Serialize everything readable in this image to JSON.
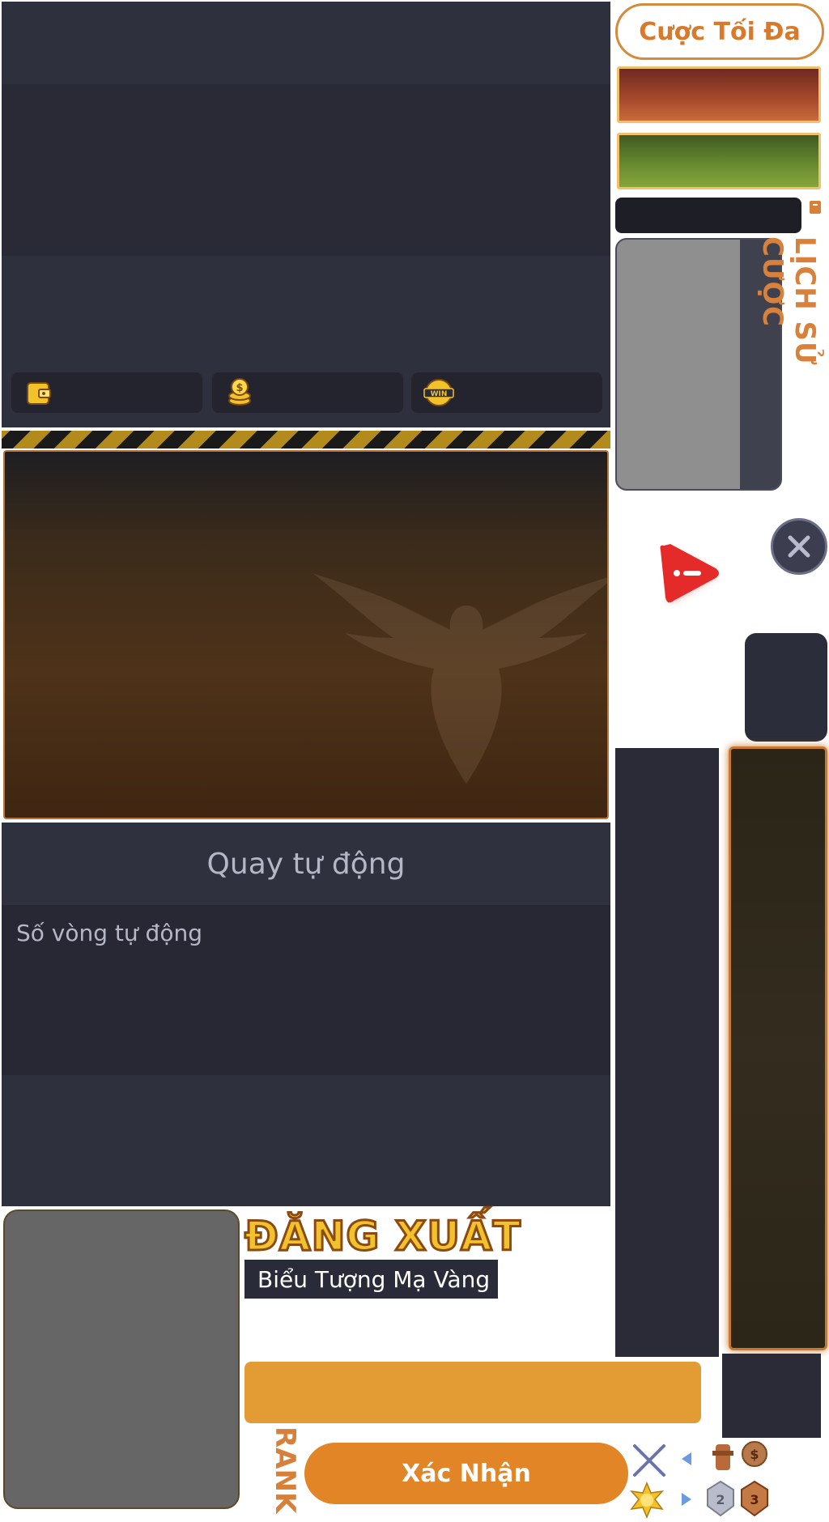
{
  "max_bet": {
    "label": "Cược Tối Đa"
  },
  "history": {
    "title": "LỊCH SỬ CƯỢC"
  },
  "auto_spin": {
    "title": "Quay tự động",
    "rounds_label": "Số vòng tự động"
  },
  "logout": {
    "label": "ĐĂNG XUẤT"
  },
  "symbol": {
    "label": "Biểu Tượng Mạ Vàng"
  },
  "rank": {
    "label": "RANK"
  },
  "confirm": {
    "label": "Xác Nhận"
  },
  "stats": {
    "icons": [
      "wallet-icon",
      "coins-icon",
      "win-icon"
    ]
  },
  "colors": {
    "accent": "#e18527",
    "panel": "#2f303d",
    "gold": "#f2c22a"
  }
}
